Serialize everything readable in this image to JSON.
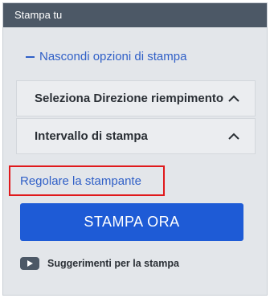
{
  "panel": {
    "title": "Stampa tu",
    "toggle_label": "Nascondi opzioni di stampa",
    "accordion": [
      {
        "label": "Seleziona Direzione riempimento"
      },
      {
        "label": "Intervallo di stampa"
      }
    ],
    "printer_link": "Regolare la stampante",
    "print_button": "STAMPA ORA",
    "tips_label": "Suggerimenti per la stampa"
  },
  "colors": {
    "header_bg": "#4c5866",
    "panel_bg": "#e3e6ea",
    "link": "#2f5fc7",
    "primary_button": "#1e5bd6",
    "highlight_border": "#e0191c"
  },
  "icons": [
    "minus-icon",
    "chevron-up-icon",
    "video-play-icon"
  ]
}
